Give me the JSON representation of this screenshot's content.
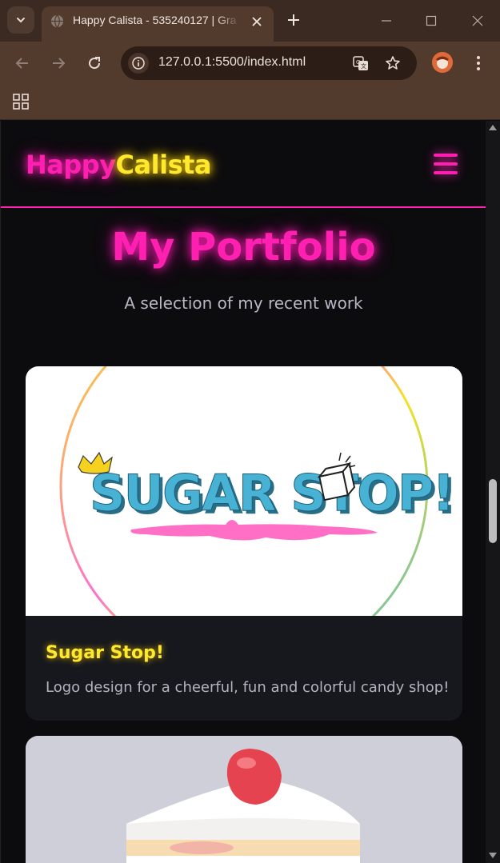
{
  "browser": {
    "tab_title": "Happy Calista - 535240127 | Gra",
    "url": "127.0.0.1:5500/index.html"
  },
  "site": {
    "logo_part1": "Happy",
    "logo_part2": "Calista",
    "page_title": "My Portfolio",
    "page_subtitle": "A selection of my recent work"
  },
  "projects": [
    {
      "title": "Sugar Stop!",
      "description": "Logo design for a cheerful, fun and colorful candy shop!",
      "image_text": "SUGAR STOP!"
    },
    {
      "title": "",
      "description": "",
      "image_alt": "strawberry shortcake illustration"
    }
  ],
  "colors": {
    "accent_pink": "#ff1fb0",
    "accent_yellow": "#ffe92e",
    "background": "#0c0b0e",
    "card_bg": "#17181d"
  },
  "scrollbar": {
    "scroll_fraction": 0.55
  }
}
